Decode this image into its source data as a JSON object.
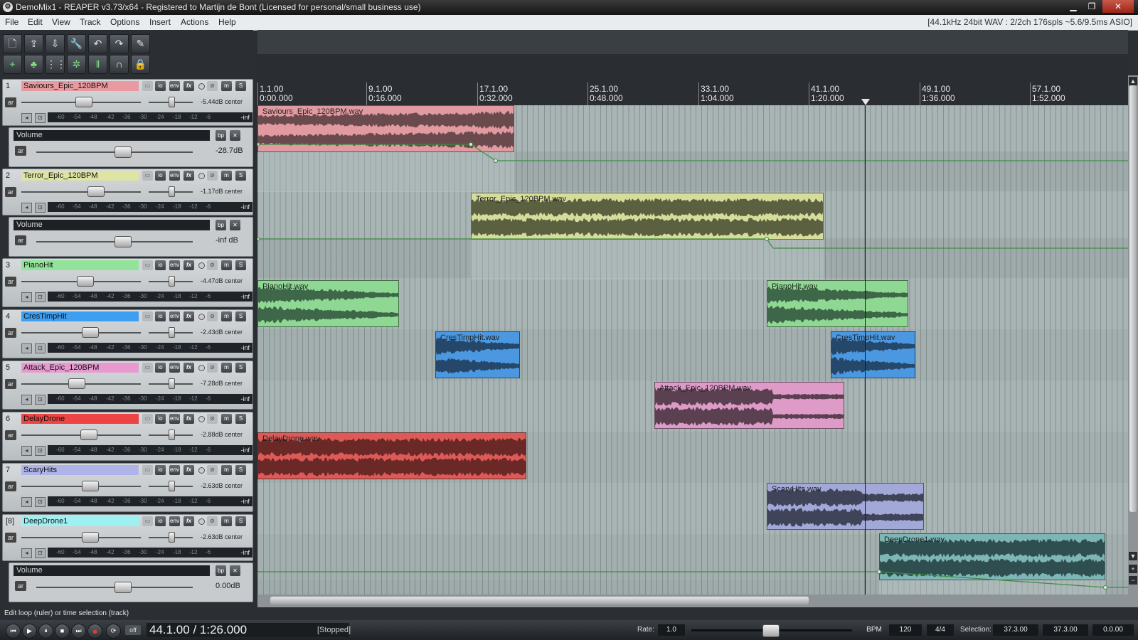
{
  "window": {
    "title": "DemoMix1 - REAPER v3.73/x64 - Registered to Martijn de Bont (Licensed for personal/small business use)",
    "min_icon": "minimize-icon",
    "max_icon": "maximize-icon",
    "close_icon": "close-icon"
  },
  "menu": {
    "items": [
      "File",
      "Edit",
      "View",
      "Track",
      "Options",
      "Insert",
      "Actions",
      "Help"
    ],
    "status": "[44.1kHz 24bit WAV : 2/2ch 176spls ~5.6/9.5ms ASIO]"
  },
  "toolbar": {
    "row1": [
      "new-project",
      "open-project",
      "save-project",
      "project-settings",
      "undo",
      "redo",
      "metronome"
    ],
    "row2": [
      "grid-snap",
      "ripple-edit",
      "grid-lines",
      "item-grouping",
      "envelope-lock",
      "auto-crossfade",
      "lock"
    ],
    "glyphs1": [
      "🗋",
      "⇪",
      "⇩",
      "🔧",
      "↶",
      "↷",
      "✎"
    ],
    "glyphs2": [
      "⌖",
      "♣",
      "⋮⋮",
      "✲",
      "‖",
      "∩",
      "🔒"
    ]
  },
  "ruler": {
    "marks": [
      {
        "bar": "1.1.00",
        "time": "0:00.000"
      },
      {
        "bar": "9.1.00",
        "time": "0:16.000"
      },
      {
        "bar": "17.1.00",
        "time": "0:32.000"
      },
      {
        "bar": "25.1.00",
        "time": "0:48.000"
      },
      {
        "bar": "33.1.00",
        "time": "1:04.000"
      },
      {
        "bar": "41.1.00",
        "time": "1:20.000"
      },
      {
        "bar": "49.1.00",
        "time": "1:36.000"
      },
      {
        "bar": "57.1.00",
        "time": "1:52.000"
      }
    ]
  },
  "meter_scale": [
    "-60",
    "-54",
    "-48",
    "-42",
    "-36",
    "-30",
    "-24",
    "-18",
    "-12",
    "-6"
  ],
  "track_buttons": {
    "io": "io",
    "env": "env",
    "fx": "fx",
    "mute": "m",
    "solo": "S",
    "arm": "ar",
    "inf": "-inf"
  },
  "tracks": [
    {
      "num": "1",
      "name": "Saviours_Epic_120BPM",
      "color": "#e89aa0",
      "volume": "-5.44dB center",
      "item_color": "#e09aa0",
      "wave_color": "#6b4a4e"
    },
    {
      "num": "2",
      "name": "Terror_Epic_120BPM",
      "color": "#dde4a4",
      "volume": "-1.17dB center",
      "item_color": "#d6dd9a",
      "wave_color": "#5a6040"
    },
    {
      "num": "3",
      "name": "PianoHit",
      "color": "#93e49a",
      "volume": "-4.47dB center",
      "item_color": "#8fd894",
      "wave_color": "#3e6648"
    },
    {
      "num": "4",
      "name": "CresTimpHit",
      "color": "#3e9ef0",
      "volume": "-2.43dB center",
      "item_color": "#4b98e0",
      "wave_color": "#25476a"
    },
    {
      "num": "5",
      "name": "Attack_Epic_120BPM",
      "color": "#e89ad0",
      "volume": "-7.28dB center",
      "item_color": "#de9bc8",
      "wave_color": "#5a4050"
    },
    {
      "num": "6",
      "name": "DelayDrone",
      "color": "#ee4444",
      "volume": "-2.88dB center",
      "item_color": "#dd5a56",
      "wave_color": "#6a2826"
    },
    {
      "num": "7",
      "name": "ScaryHits",
      "color": "#aeb4e8",
      "volume": "-2.63dB center",
      "item_color": "#a2a8d8",
      "wave_color": "#3f4458"
    },
    {
      "num": "[8]",
      "name": "DeepDrone1",
      "color": "#9df1f1",
      "volume": "-2.63dB center",
      "item_color": "#7eb5b5",
      "wave_color": "#2e4e50"
    }
  ],
  "envelopes": [
    {
      "label": "Volume",
      "value": "-28.7dB",
      "bypass": "bp",
      "close": "✕"
    },
    {
      "label": "Volume",
      "value": "-inf dB",
      "bypass": "bp",
      "close": "✕"
    },
    {
      "label": "Volume",
      "value": "0.00dB",
      "bypass": "bp",
      "close": "✕"
    }
  ],
  "items": [
    {
      "name": "Saviours_Epic_120BPM.wav"
    },
    {
      "name": "Terror_Epic_120BPM.wav"
    },
    {
      "name": "PianoHit.wav"
    },
    {
      "name": "PianoHit.wav"
    },
    {
      "name": "CresTimpHit.wav"
    },
    {
      "name": "CresTimpHit.wav"
    },
    {
      "name": "Attack_Epic_120BPM.wav"
    },
    {
      "name": "DelayDrone.wav"
    },
    {
      "name": "ScaryHits.wav"
    },
    {
      "name": "DeepDrone1.wav"
    }
  ],
  "status_line": "Edit loop (ruler) or time selection (track)",
  "transport": {
    "buttons": [
      "⏮",
      "▶",
      "⏸",
      "■",
      "⏭",
      "●",
      "⟳"
    ],
    "off": "off",
    "position": "44.1.00 / 1:26.000",
    "state": "[Stopped]",
    "rate_label": "Rate:",
    "rate_value": "1.0",
    "bpm_label": "BPM",
    "bpm_value": "120",
    "time_sig": "4/4",
    "selection_label": "Selection:",
    "sel_start": "37.3.00",
    "sel_end": "37.3.00",
    "sel_len": "0.0.00"
  }
}
